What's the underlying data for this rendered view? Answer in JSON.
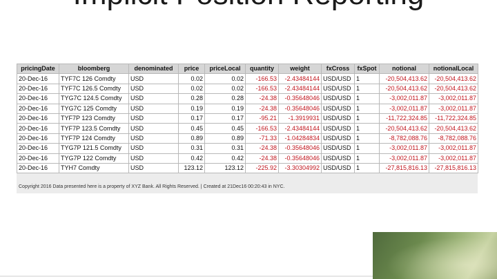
{
  "slide": {
    "title": "Implicit Position Reporting"
  },
  "table": {
    "headers": [
      "pricingDate",
      "bloomberg",
      "denominated",
      "price",
      "priceLocal",
      "quantity",
      "weight",
      "fxCross",
      "fxSpot",
      "notional",
      "notionalLocal"
    ],
    "rows": [
      [
        "20-Dec-16",
        "TYF7C 126 Comdty",
        "USD",
        "0.02",
        "0.02",
        "-166.53",
        "-2.43484144",
        "USD/USD",
        "1",
        "-20,504,413.62",
        "-20,504,413.62"
      ],
      [
        "20-Dec-16",
        "TYF7C 126.5 Comdty",
        "USD",
        "0.02",
        "0.02",
        "-166.53",
        "-2.43484144",
        "USD/USD",
        "1",
        "-20,504,413.62",
        "-20,504,413.62"
      ],
      [
        "20-Dec-16",
        "TYG7C 124.5 Comdty",
        "USD",
        "0.28",
        "0.28",
        "-24.38",
        "-0.35648046",
        "USD/USD",
        "1",
        "-3,002,011.87",
        "-3,002,011.87"
      ],
      [
        "20-Dec-16",
        "TYG7C 125 Comdty",
        "USD",
        "0.19",
        "0.19",
        "-24.38",
        "-0.35648046",
        "USD/USD",
        "1",
        "-3,002,011.87",
        "-3,002,011.87"
      ],
      [
        "20-Dec-16",
        "TYF7P 123 Comdty",
        "USD",
        "0.17",
        "0.17",
        "-95.21",
        "-1.3919931",
        "USD/USD",
        "1",
        "-11,722,324.85",
        "-11,722,324.85"
      ],
      [
        "20-Dec-16",
        "TYF7P 123.5 Comdty",
        "USD",
        "0.45",
        "0.45",
        "-166.53",
        "-2.43484144",
        "USD/USD",
        "1",
        "-20,504,413.62",
        "-20,504,413.62"
      ],
      [
        "20-Dec-16",
        "TYF7P 124 Comdty",
        "USD",
        "0.89",
        "0.89",
        "-71.33",
        "-1.04284834",
        "USD/USD",
        "1",
        "-8,782,088.76",
        "-8,782,088.76"
      ],
      [
        "20-Dec-16",
        "TYG7P 121.5 Comdty",
        "USD",
        "0.31",
        "0.31",
        "-24.38",
        "-0.35648046",
        "USD/USD",
        "1",
        "-3,002,011.87",
        "-3,002,011.87"
      ],
      [
        "20-Dec-16",
        "TYG7P 122 Comdty",
        "USD",
        "0.42",
        "0.42",
        "-24.38",
        "-0.35648046",
        "USD/USD",
        "1",
        "-3,002,011.87",
        "-3,002,011.87"
      ],
      [
        "20-Dec-16",
        "TYH7 Comdty",
        "USD",
        "123.12",
        "123.12",
        "-225.92",
        "-3.30304992",
        "USD/USD",
        "1",
        "-27,815,816.13",
        "-27,815,816.13"
      ]
    ],
    "footer": "Copyright 2016 Data presented here is a property of XYZ Bank. All Rights Reserved. | Created at 21Dec16 00:20:43 in NYC."
  },
  "colors": {
    "negative": "#c0141c",
    "header_bg": "#d6d6d6"
  }
}
